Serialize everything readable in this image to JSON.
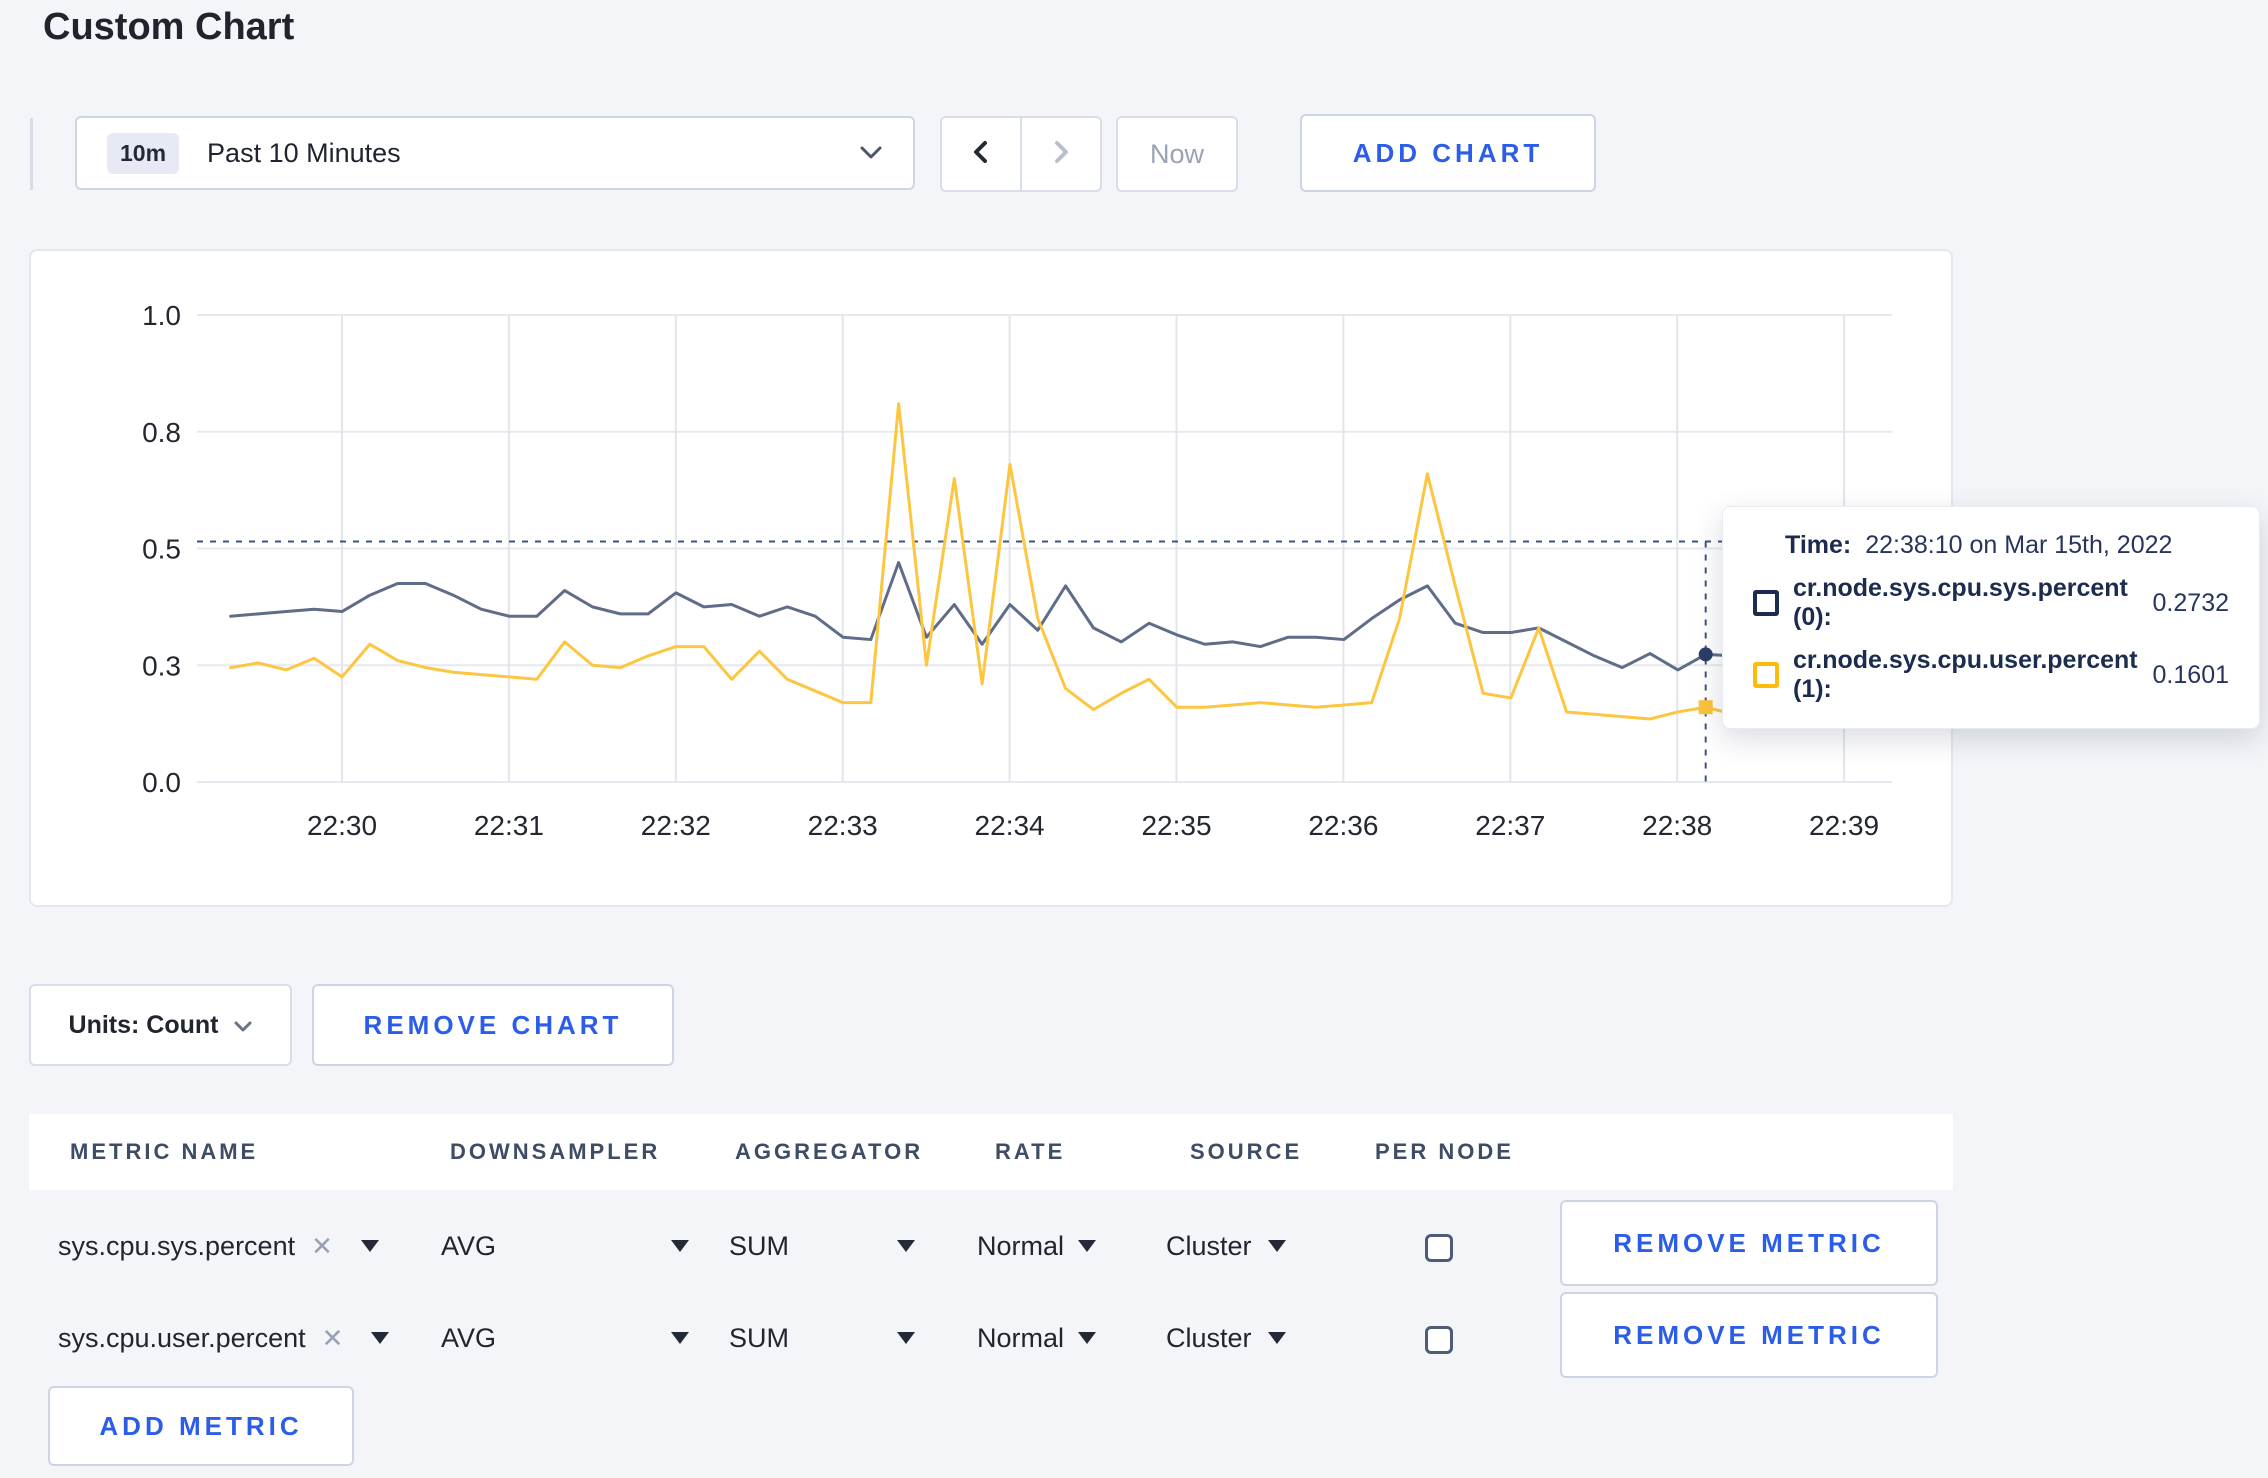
{
  "page": {
    "title": "Custom Chart"
  },
  "colors": {
    "accent_blue": "#2b5de8",
    "page_bg": "#f4f5f9",
    "navy": "#1c2c4f"
  },
  "toolbar": {
    "time_selector": {
      "badge": "10m",
      "label": "Past 10 Minutes"
    },
    "now_label": "Now",
    "add_chart_label": "ADD CHART"
  },
  "icons": {
    "clear_glyph": "✕"
  },
  "tooltip": {
    "time_label": "Time:",
    "time_value": "22:38:10 on Mar 15th, 2022",
    "series": [
      {
        "label": "cr.node.sys.cpu.sys.percent (0):",
        "value": "0.2732",
        "color": "#1c2c4f"
      },
      {
        "label": "cr.node.sys.cpu.user.percent (1):",
        "value": "0.1601",
        "color": "#fdbb0b"
      }
    ]
  },
  "units_button": {
    "label": "Units: Count"
  },
  "remove_chart_label": "REMOVE CHART",
  "metrics_table": {
    "headers": [
      "METRIC NAME",
      "DOWNSAMPLER",
      "AGGREGATOR",
      "RATE",
      "SOURCE",
      "PER NODE"
    ],
    "rows": [
      {
        "metric": "sys.cpu.sys.percent",
        "downsampler": "AVG",
        "aggregator": "SUM",
        "rate": "Normal",
        "source": "Cluster",
        "per_node": false,
        "remove_label": "REMOVE METRIC"
      },
      {
        "metric": "sys.cpu.user.percent",
        "downsampler": "AVG",
        "aggregator": "SUM",
        "rate": "Normal",
        "source": "Cluster",
        "per_node": false,
        "remove_label": "REMOVE METRIC"
      }
    ],
    "add_metric_label": "ADD METRIC"
  },
  "chart_data": {
    "type": "line",
    "title": "",
    "ylim": [
      0,
      1
    ],
    "yticks": [
      {
        "v": 0,
        "label": "0.0"
      },
      {
        "v": 0.25,
        "label": "0.3"
      },
      {
        "v": 0.5,
        "label": "0.5"
      },
      {
        "v": 0.75,
        "label": "0.8"
      },
      {
        "v": 1,
        "label": "1.0"
      }
    ],
    "xticks": [
      "22:30",
      "22:31",
      "22:32",
      "22:33",
      "22:34",
      "22:35",
      "22:36",
      "22:37",
      "22:38",
      "22:39"
    ],
    "grid": true,
    "x": [
      "22:29:20",
      "22:29:30",
      "22:29:40",
      "22:29:50",
      "22:30:00",
      "22:30:10",
      "22:30:20",
      "22:30:30",
      "22:30:40",
      "22:30:50",
      "22:31:00",
      "22:31:10",
      "22:31:20",
      "22:31:30",
      "22:31:40",
      "22:31:50",
      "22:32:00",
      "22:32:10",
      "22:32:20",
      "22:32:30",
      "22:32:40",
      "22:32:50",
      "22:33:00",
      "22:33:10",
      "22:33:20",
      "22:33:30",
      "22:33:40",
      "22:33:50",
      "22:34:00",
      "22:34:10",
      "22:34:20",
      "22:34:30",
      "22:34:40",
      "22:34:50",
      "22:35:00",
      "22:35:10",
      "22:35:20",
      "22:35:30",
      "22:35:40",
      "22:35:50",
      "22:36:00",
      "22:36:10",
      "22:36:20",
      "22:36:30",
      "22:36:40",
      "22:36:50",
      "22:37:00",
      "22:37:10",
      "22:37:20",
      "22:37:30",
      "22:37:40",
      "22:37:50",
      "22:38:00",
      "22:38:10",
      "22:38:20",
      "22:38:30",
      "22:38:40",
      "22:38:50",
      "22:39:00",
      "22:39:10"
    ],
    "series": [
      {
        "name": "cr.node.sys.cpu.sys.percent",
        "color": "#5f6d89",
        "values": [
          0.355,
          0.36,
          0.365,
          0.37,
          0.365,
          0.4,
          0.425,
          0.425,
          0.4,
          0.37,
          0.355,
          0.355,
          0.41,
          0.375,
          0.36,
          0.36,
          0.405,
          0.375,
          0.38,
          0.355,
          0.375,
          0.355,
          0.31,
          0.305,
          0.47,
          0.31,
          0.38,
          0.295,
          0.38,
          0.325,
          0.42,
          0.33,
          0.3,
          0.34,
          0.315,
          0.295,
          0.3,
          0.29,
          0.31,
          0.31,
          0.305,
          0.35,
          0.39,
          0.42,
          0.34,
          0.32,
          0.32,
          0.33,
          0.3,
          0.27,
          0.245,
          0.275,
          0.24,
          0.2732,
          0.27,
          0.25,
          0.26,
          0.25,
          0.26,
          0.25
        ]
      },
      {
        "name": "cr.node.sys.cpu.user.percent",
        "color": "#fdc640",
        "values": [
          0.245,
          0.255,
          0.24,
          0.265,
          0.225,
          0.295,
          0.26,
          0.245,
          0.235,
          0.23,
          0.225,
          0.22,
          0.3,
          0.25,
          0.245,
          0.27,
          0.29,
          0.29,
          0.22,
          0.28,
          0.22,
          0.195,
          0.17,
          0.17,
          0.81,
          0.25,
          0.65,
          0.21,
          0.68,
          0.35,
          0.2,
          0.155,
          0.19,
          0.22,
          0.16,
          0.16,
          0.165,
          0.17,
          0.165,
          0.16,
          0.165,
          0.17,
          0.35,
          0.66,
          0.42,
          0.19,
          0.18,
          0.33,
          0.15,
          0.145,
          0.14,
          0.135,
          0.15,
          0.1601,
          0.145,
          0.14,
          0.31,
          0.24,
          0.175,
          0.26
        ]
      }
    ],
    "crosshair": {
      "x": "22:38:10",
      "hline": 0.515,
      "color": "#3f5578",
      "markers": [
        {
          "value": 0.2732,
          "color": "#2c3e66",
          "shape": "circle"
        },
        {
          "value": 0.1601,
          "color": "#fdc33c",
          "shape": "square"
        }
      ]
    }
  }
}
